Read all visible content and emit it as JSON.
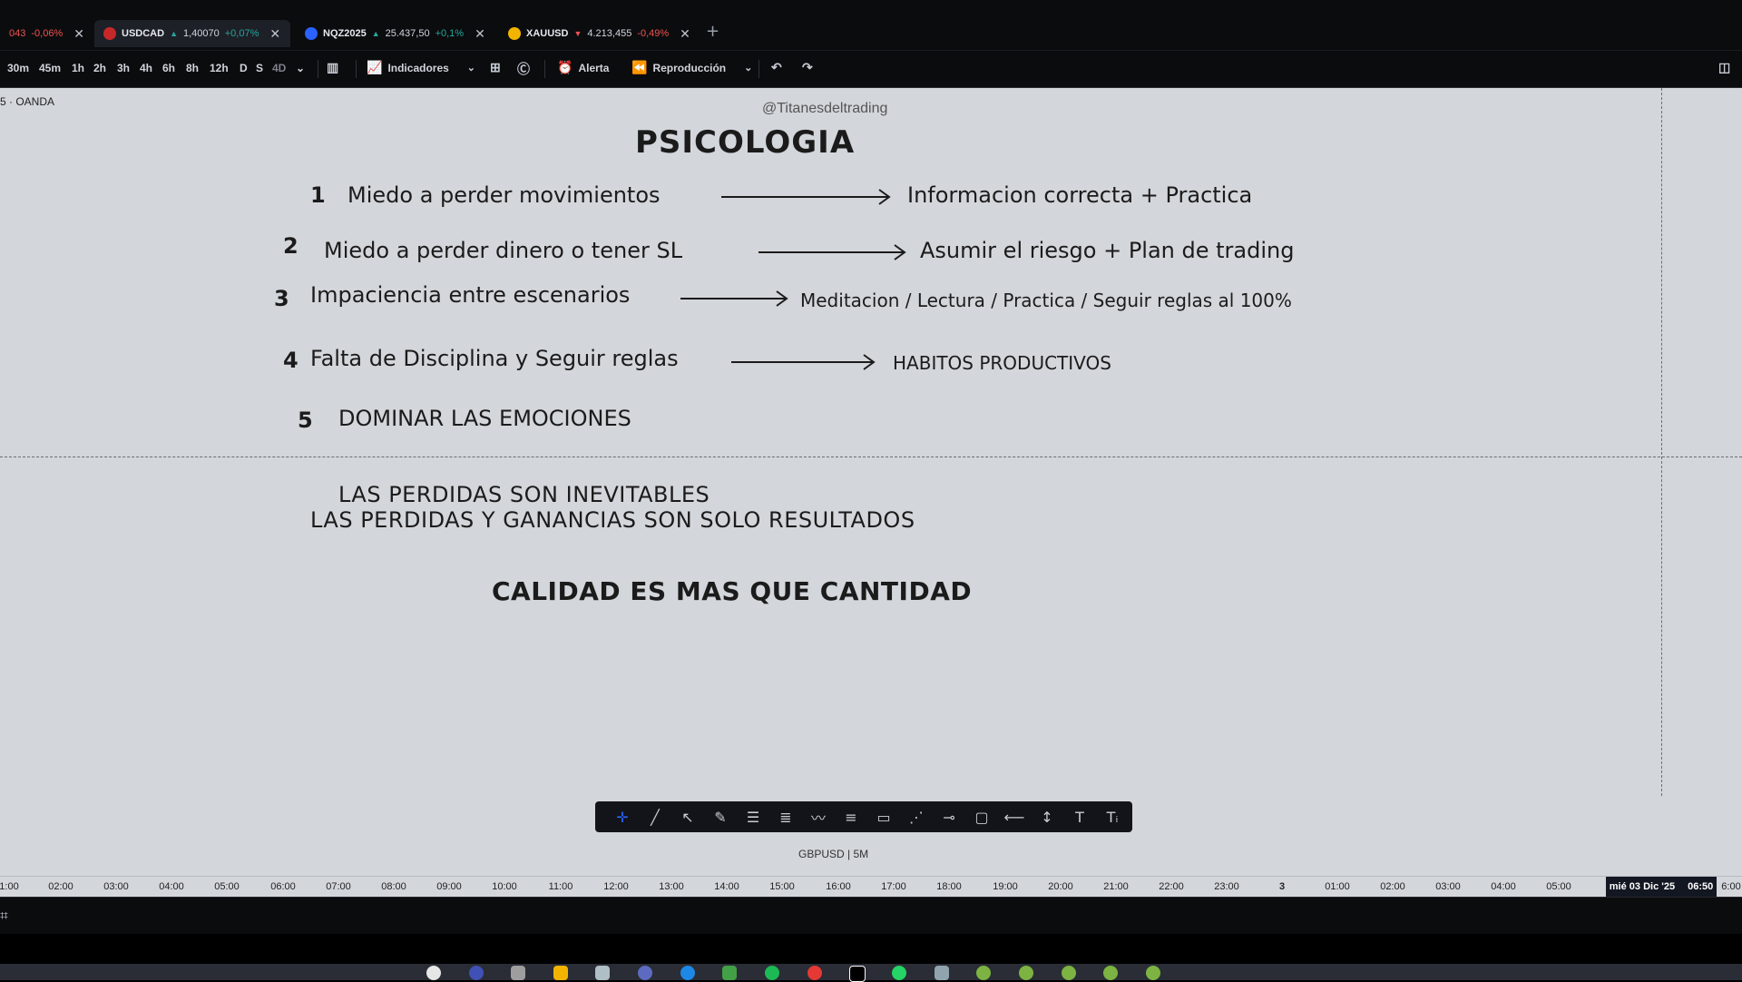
{
  "tabs": [
    {
      "symbol": "",
      "price": "043",
      "change": "-0,06%",
      "direction": "down",
      "icon_color": ""
    },
    {
      "symbol": "USDCAD",
      "price": "1,40070",
      "change": "+0,07%",
      "direction": "up",
      "icon_color": "#c62828"
    },
    {
      "symbol": "NQZ2025",
      "price": "25.437,50",
      "change": "+0,1%",
      "direction": "up",
      "icon_color": "#2962ff"
    },
    {
      "symbol": "XAUUSD",
      "price": "4.213,455",
      "change": "-0,49%",
      "direction": "down",
      "icon_color": "#f2b400"
    }
  ],
  "toolbar": {
    "timeframes": [
      "30m",
      "45m",
      "1h",
      "2h",
      "3h",
      "4h",
      "6h",
      "8h",
      "12h",
      "D",
      "S",
      "4D"
    ],
    "indicators_label": "Indicadores",
    "alert_label": "Alerta",
    "replay_label": "Reproducción"
  },
  "chart": {
    "exchange": "5 · OANDA",
    "handle": "@Titanesdeltrading",
    "title": "PSICOLOGIA",
    "items": [
      {
        "num": "1",
        "text": "Miedo a perder movimientos",
        "answer": "Informacion correcta + Practica"
      },
      {
        "num": "2",
        "text": "Miedo a perder dinero o tener SL",
        "answer": "Asumir el riesgo + Plan de trading"
      },
      {
        "num": "3",
        "text": "Impaciencia entre escenarios",
        "answer": "Meditacion / Lectura / Practica / Seguir reglas al 100%"
      },
      {
        "num": "4",
        "text": "Falta de Disciplina y Seguir reglas",
        "answer": "HABITOS PRODUCTIVOS"
      },
      {
        "num": "5",
        "text": "DOMINAR LAS EMOCIONES",
        "answer": ""
      }
    ],
    "notes": {
      "line1": "LAS PERDIDAS SON INEVITABLES",
      "line2": "LAS PERDIDAS Y GANANCIAS SON SOLO RESULTADOS",
      "line3": "CALIDAD ES MAS QUE CANTIDAD"
    },
    "symbol_label": "GBPUSD | 5M"
  },
  "drawing_tools": [
    "crosshair-icon",
    "trend-line-icon",
    "cursor-icon",
    "brush-icon",
    "fib-icon",
    "channel-icon",
    "wave-icon",
    "lines-icon",
    "rectangle-icon",
    "pattern-icon",
    "measure-icon",
    "callout-icon",
    "ray-icon",
    "vertical-line-icon",
    "text-icon",
    "text-note-icon"
  ],
  "time_axis": {
    "ticks": [
      "1:00",
      "02:00",
      "03:00",
      "04:00",
      "05:00",
      "06:00",
      "07:00",
      "08:00",
      "09:00",
      "10:00",
      "11:00",
      "12:00",
      "13:00",
      "14:00",
      "15:00",
      "16:00",
      "17:00",
      "18:00",
      "19:00",
      "20:00",
      "21:00",
      "22:00",
      "23:00",
      "3",
      "01:00",
      "02:00",
      "03:00",
      "04:00",
      "05:00"
    ],
    "current_date": "mié 03 Dic '25",
    "current_time": "06:50",
    "trailing": "6:00"
  }
}
